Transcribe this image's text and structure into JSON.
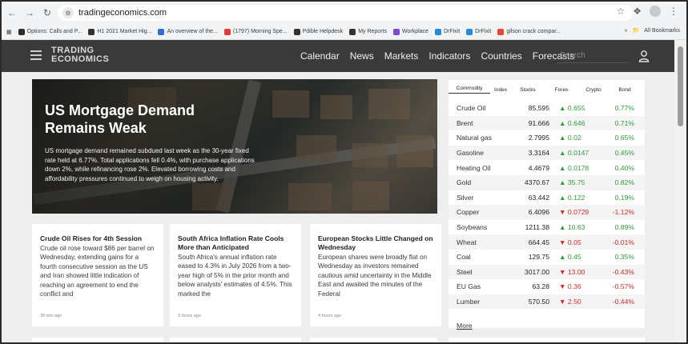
{
  "browser": {
    "url": "tradingeconomics.com",
    "bookmarks": [
      {
        "label": "Options: Calls and P...",
        "color": "#2d2d2d"
      },
      {
        "label": "H1 2021 Market Hig...",
        "color": "#333333"
      },
      {
        "label": "An overview of the...",
        "color": "#2b6fd6"
      },
      {
        "label": "(1797) Morning Spe...",
        "color": "#e53935"
      },
      {
        "label": "Pdible Helpdesk",
        "color": "#333333"
      },
      {
        "label": "My Reports",
        "color": "#333333"
      },
      {
        "label": "Workplace",
        "color": "#7b4ad6"
      },
      {
        "label": "DrFixit",
        "color": "#2b88d8"
      },
      {
        "label": "DrFixit",
        "color": "#2b88d8"
      },
      {
        "label": "gilson crack compar...",
        "color": "#ea4335"
      }
    ],
    "all_bookmarks": "All Bookmarks"
  },
  "header": {
    "logo_line1": "TRADING",
    "logo_line2": "ECONOMICS",
    "nav": [
      "Calendar",
      "News",
      "Markets",
      "Indicators",
      "Countries",
      "Forecasts"
    ],
    "search_placeholder": "Search"
  },
  "hero": {
    "title": "US Mortgage Demand Remains Weak",
    "text": "US mortgage demand remained subdued last week as the 30-year fixed rate held at 6.77%. Total applications fell 0.4%, with purchase applications down 2%, while refinancing rose 2%. Elevated borrowing costs and affordability pressures continued to weigh on housing activity."
  },
  "news": [
    {
      "title": "Crude Oil Rises for 4th Session",
      "body": "Crude oil rose toward $86 per barrel on Wednesday, extending gains for a fourth consecutive session as the US and Iran showed little indication of reaching an agreement to end the conflict and",
      "time": "38 min ago"
    },
    {
      "title": "South Africa Inflation Rate Cools More than Anticipated",
      "body": "South Africa's annual inflation rate eased to 4.3% in July 2026 from a two-year high of 5% in the prior month and below analysts' estimates of 4.5%. This marked the",
      "time": "3 hours ago"
    },
    {
      "title": "European Stocks Little Changed on Wednesday",
      "body": "European shares were broadly flat on Wednesday as investors remained cautious amid uncertainty in the Middle East and awaited the minutes of the Federal",
      "time": "4 hours ago"
    }
  ],
  "market": {
    "tabs": [
      "Commodity",
      "Index",
      "Stocks",
      "Forex",
      "Crypto",
      "Bond"
    ],
    "active_tab": "Commodity",
    "rows": [
      {
        "name": "Crude Oil",
        "price": "85.595",
        "change": "0.655",
        "dir": "up",
        "pct": "0.77%"
      },
      {
        "name": "Brent",
        "price": "91.666",
        "change": "0.646",
        "dir": "up",
        "pct": "0.71%"
      },
      {
        "name": "Natural gas",
        "price": "2.7995",
        "change": "0.02",
        "dir": "up",
        "pct": "0.65%"
      },
      {
        "name": "Gasoline",
        "price": "3.3164",
        "change": "0.0147",
        "dir": "up",
        "pct": "0.45%"
      },
      {
        "name": "Heating Oil",
        "price": "4.4679",
        "change": "0.0178",
        "dir": "up",
        "pct": "0.40%"
      },
      {
        "name": "Gold",
        "price": "4370.67",
        "change": "35.75",
        "dir": "up",
        "pct": "0.82%"
      },
      {
        "name": "Silver",
        "price": "63.442",
        "change": "0.122",
        "dir": "up",
        "pct": "0.19%"
      },
      {
        "name": "Copper",
        "price": "6.4096",
        "change": "0.0729",
        "dir": "down",
        "pct": "-1.12%"
      },
      {
        "name": "Soybeans",
        "price": "1211.38",
        "change": "10.63",
        "dir": "up",
        "pct": "0.89%"
      },
      {
        "name": "Wheat",
        "price": "664.45",
        "change": "0.05",
        "dir": "down",
        "pct": "-0.01%"
      },
      {
        "name": "Coal",
        "price": "129.75",
        "change": "0.45",
        "dir": "up",
        "pct": "0.35%"
      },
      {
        "name": "Steel",
        "price": "3017.00",
        "change": "13.00",
        "dir": "down",
        "pct": "-0.43%"
      },
      {
        "name": "EU Gas",
        "price": "63.28",
        "change": "0.36",
        "dir": "down",
        "pct": "-0.57%"
      },
      {
        "name": "Lumber",
        "price": "570.50",
        "change": "2.50",
        "dir": "down",
        "pct": "-0.44%"
      }
    ],
    "more_label": "More",
    "colors": {
      "up": "#2e9e3a",
      "down": "#d12a2a"
    }
  }
}
